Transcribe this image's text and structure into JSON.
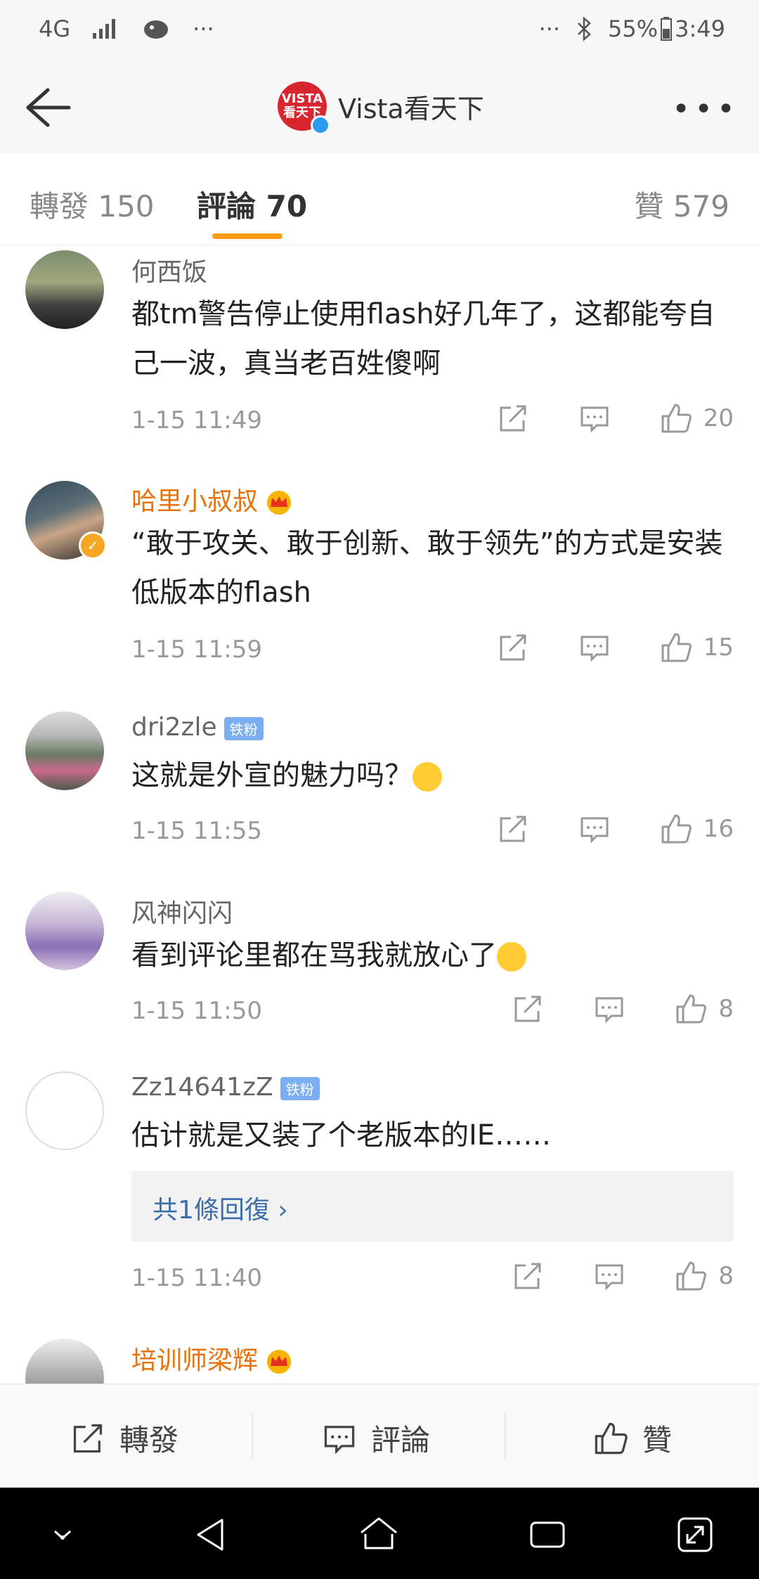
{
  "status_bar": {
    "network": "4G",
    "dots_left": "···",
    "dots_right": "···",
    "battery": "55%",
    "time": "3:49"
  },
  "header": {
    "title": "Vista看天下",
    "logo_top": "VISTA",
    "logo_bottom": "看天下",
    "more": "•••"
  },
  "tabs": [
    {
      "label": "轉發 150"
    },
    {
      "label": "評論 70"
    },
    {
      "label": "贊 579"
    }
  ],
  "comments": [
    {
      "user": "何西饭",
      "text": "都tm警告停止使用flash好几年了，这都能夸自己一波，真当老百姓傻啊",
      "time": "1-15 11:49",
      "likes": "20"
    },
    {
      "user": "哈里小叔叔",
      "text": "“敢于攻关、敢于创新、敢于领先”的方式是安装低版本的flash",
      "time": "1-15 11:59",
      "likes": "15"
    },
    {
      "user": "dri2zle",
      "badge": "铁粉",
      "text": "这就是外宣的魅力吗？",
      "time": "1-15 11:55",
      "likes": "16"
    },
    {
      "user": "风神闪闪",
      "text": "看到评论里都在骂我就放心了",
      "time": "1-15 11:50",
      "likes": "8"
    },
    {
      "user": "Zz14641zZ",
      "badge": "铁粉",
      "text": "估计就是又装了个老版本的IE……",
      "reply": "共1條回復 ›",
      "time": "1-15 11:40",
      "likes": "8"
    },
    {
      "user": "培训师梁辉"
    }
  ],
  "bottom_bar": {
    "repost": "轉發",
    "comment": "評論",
    "like": "贊"
  },
  "colors": {
    "accent": "#f79b16",
    "gold_name": "#e8710a",
    "link": "#3c6eaa"
  }
}
